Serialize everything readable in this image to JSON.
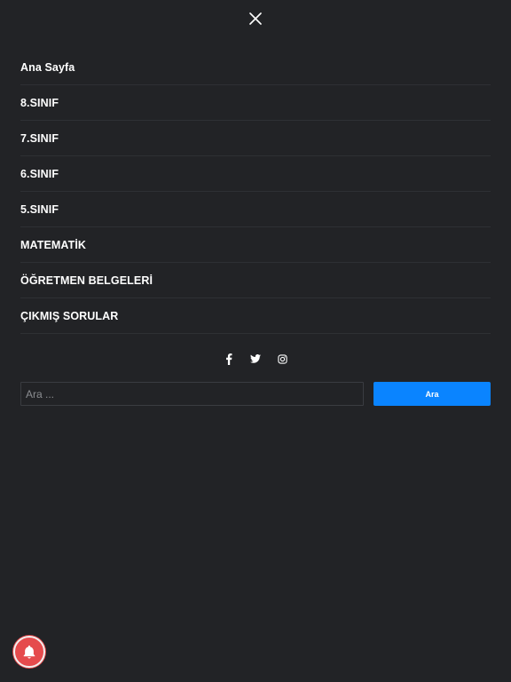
{
  "close": {
    "icon": "close-icon"
  },
  "menu": {
    "items": [
      {
        "label": "Ana Sayfa"
      },
      {
        "label": "8.SINIF"
      },
      {
        "label": "7.SINIF"
      },
      {
        "label": "6.SINIF"
      },
      {
        "label": "5.SINIF"
      },
      {
        "label": "MATEMATİK"
      },
      {
        "label": "ÖĞRETMEN BELGELERİ"
      },
      {
        "label": "ÇIKMIŞ SORULAR"
      }
    ]
  },
  "social": {
    "icons": [
      "facebook-icon",
      "twitter-icon",
      "instagram-icon"
    ]
  },
  "search": {
    "placeholder": "Ara ...",
    "value": "",
    "button_label": "Ara"
  },
  "notification": {
    "icon": "bell-icon"
  },
  "colors": {
    "background": "#222326",
    "accent": "#0a84ff",
    "notification": "#e54b4d",
    "divider": "#2e3034",
    "input_border": "#3a3c41"
  }
}
